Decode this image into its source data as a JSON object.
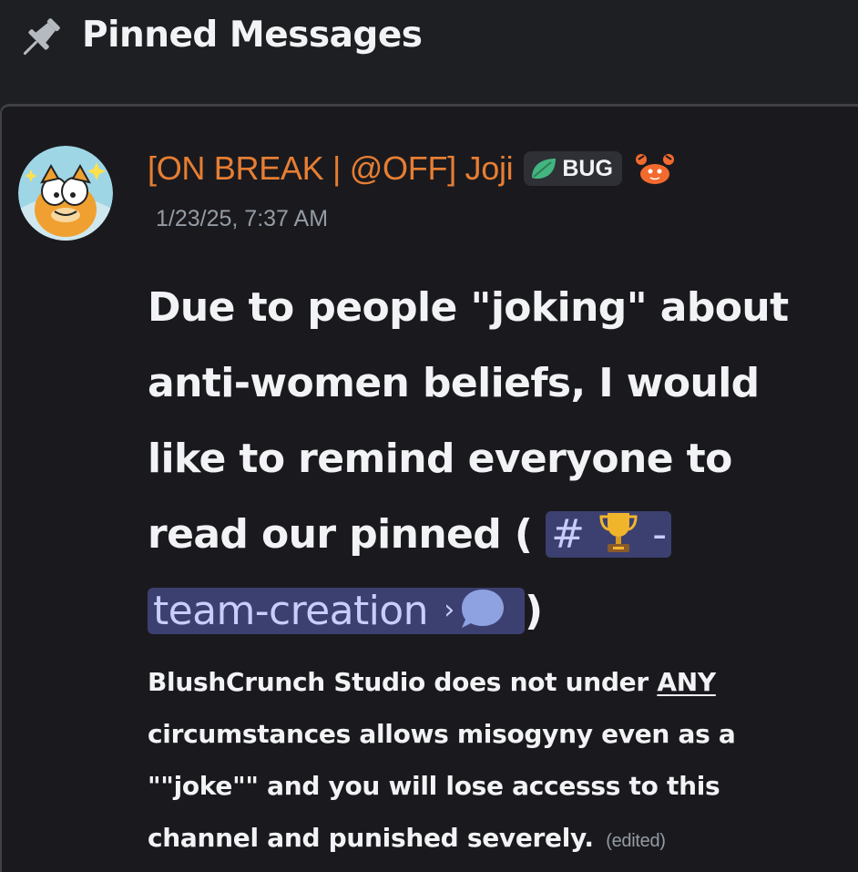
{
  "header": {
    "title": "Pinned Messages",
    "icon": "pin-icon"
  },
  "message": {
    "author": "[ON BREAK | @OFF] Joji",
    "author_color": "#e67e33",
    "badge_label": "BUG",
    "badge_icon": "leaf-icon",
    "role_icon": "crab-icon",
    "timestamp": "1/23/25, 7:37 AM",
    "headline": {
      "line1": "Due to people \"joking\" about",
      "line2": "anti-women beliefs, I would",
      "line3": "like to remind everyone to",
      "line4_pre": "read our pinned (",
      "channel_hash": "#",
      "channel_dash": "-",
      "channel_name": "team-creation",
      "channel_chevron": "›",
      "line5_post": ")"
    },
    "body": {
      "line1_pre": "BlushCrunch Studio does not under ",
      "line1_emph": "ANY",
      "line2": "circumstances allows misogyny even as a",
      "line3": "\"\"joke\"\" and you will lose accesss to this",
      "line4": "channel and punished severely.",
      "edited": "(edited)"
    }
  },
  "colors": {
    "background": "#1e1f22",
    "panel": "#1a1a1e",
    "mention_bg": "#3c4070",
    "mention_text": "#c9cdfb",
    "muted": "#949ba4"
  }
}
